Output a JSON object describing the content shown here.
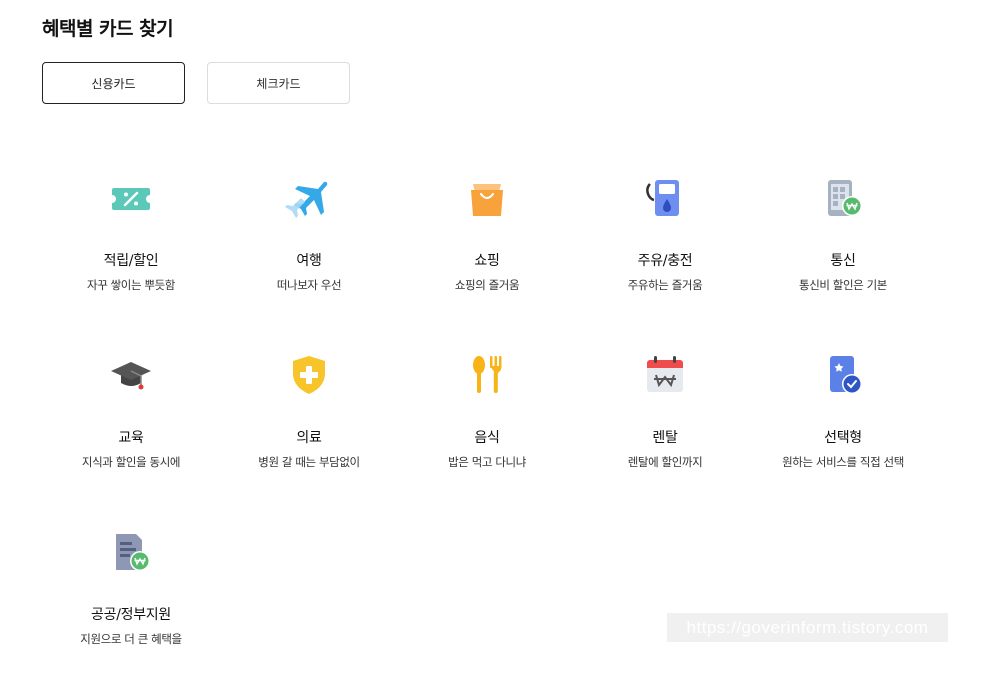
{
  "page": {
    "title": "혜택별 카드 찾기"
  },
  "tabs": [
    {
      "label": "신용카드",
      "active": true
    },
    {
      "label": "체크카드",
      "active": false
    }
  ],
  "categories": [
    {
      "name": "적립/할인",
      "desc": "자꾸 쌓이는 뿌듯함",
      "icon": "coupon-icon",
      "color": "#5cc9b8"
    },
    {
      "name": "여행",
      "desc": "떠나보자 우선",
      "icon": "airplane-icon",
      "color": "#35a9e8"
    },
    {
      "name": "쇼핑",
      "desc": "쇼핑의 즐거움",
      "icon": "shopping-bag-icon",
      "color": "#f8a23c"
    },
    {
      "name": "주유/충전",
      "desc": "주유하는 즐거움",
      "icon": "fuel-pump-icon",
      "color": "#6f8ff0"
    },
    {
      "name": "통신",
      "desc": "통신비 할인은 기본",
      "icon": "phone-won-icon",
      "color": "#56bb6c"
    },
    {
      "name": "교육",
      "desc": "지식과 할인을 동시에",
      "icon": "graduation-cap-icon",
      "color": "#555555"
    },
    {
      "name": "의료",
      "desc": "병원 갈 때는 부담없이",
      "icon": "medical-shield-icon",
      "color": "#f7c42b"
    },
    {
      "name": "음식",
      "desc": "밥은 먹고 다니냐",
      "icon": "spoon-fork-icon",
      "color": "#f7b318"
    },
    {
      "name": "렌탈",
      "desc": "렌탈에 할인까지",
      "icon": "calendar-won-icon",
      "color": "#f04c4c"
    },
    {
      "name": "선택형",
      "desc": "원하는 서비스를 직접 선택",
      "icon": "bookmark-check-icon",
      "color": "#5b80e8"
    },
    {
      "name": "공공/정부지원",
      "desc": "지원으로 더 큰 혜택을",
      "icon": "document-won-icon",
      "color": "#56bb6c"
    }
  ],
  "watermark": {
    "text": "https://goverinform.tistory.com"
  }
}
